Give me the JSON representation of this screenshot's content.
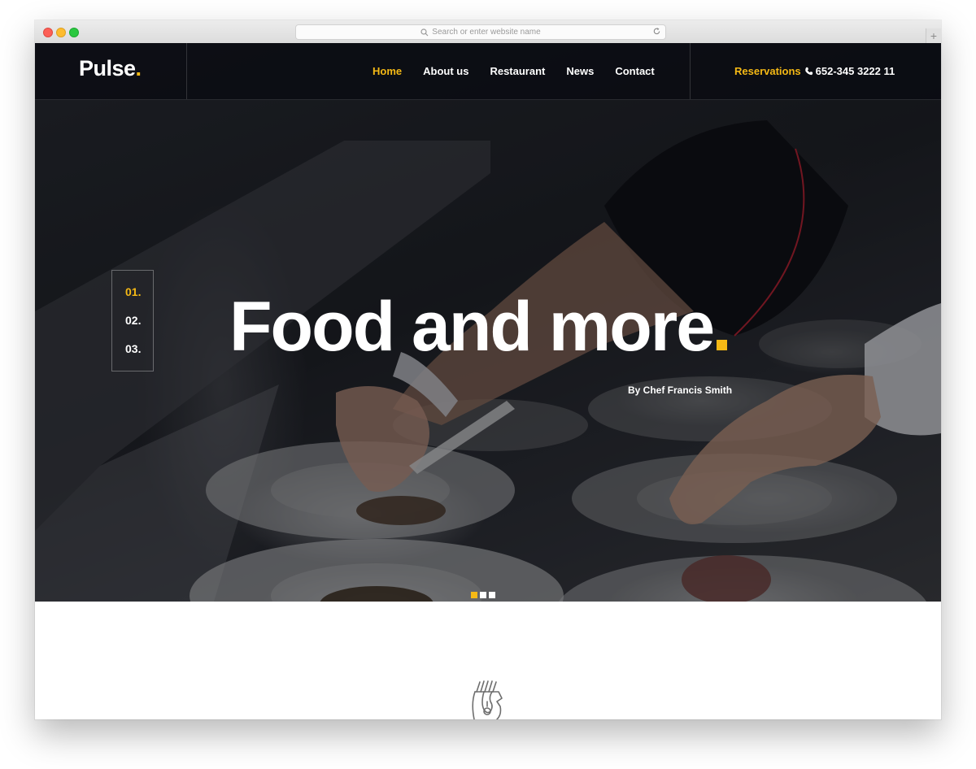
{
  "browser": {
    "url_placeholder": "Search or enter website name",
    "new_tab_label": "+"
  },
  "site": {
    "brand": "Pulse",
    "brand_dot": ".",
    "nav": [
      {
        "label": "Home",
        "active": true
      },
      {
        "label": "About us",
        "active": false
      },
      {
        "label": "Restaurant",
        "active": false
      },
      {
        "label": "News",
        "active": false
      },
      {
        "label": "Contact",
        "active": false
      }
    ],
    "reservations": {
      "label": "Reservations",
      "phone_icon": "phone-icon",
      "number": "652-345 3222 11"
    }
  },
  "hero": {
    "slides": [
      "01.",
      "02.",
      "03."
    ],
    "active_slide": 1,
    "headline": "Food and more",
    "byline": "By Chef Francis Smith",
    "bullet_count": 3
  },
  "colors": {
    "accent": "#f5b915",
    "nav_bg": "#080a10",
    "white": "#ffffff"
  },
  "section_icon": "food-hand-icon"
}
